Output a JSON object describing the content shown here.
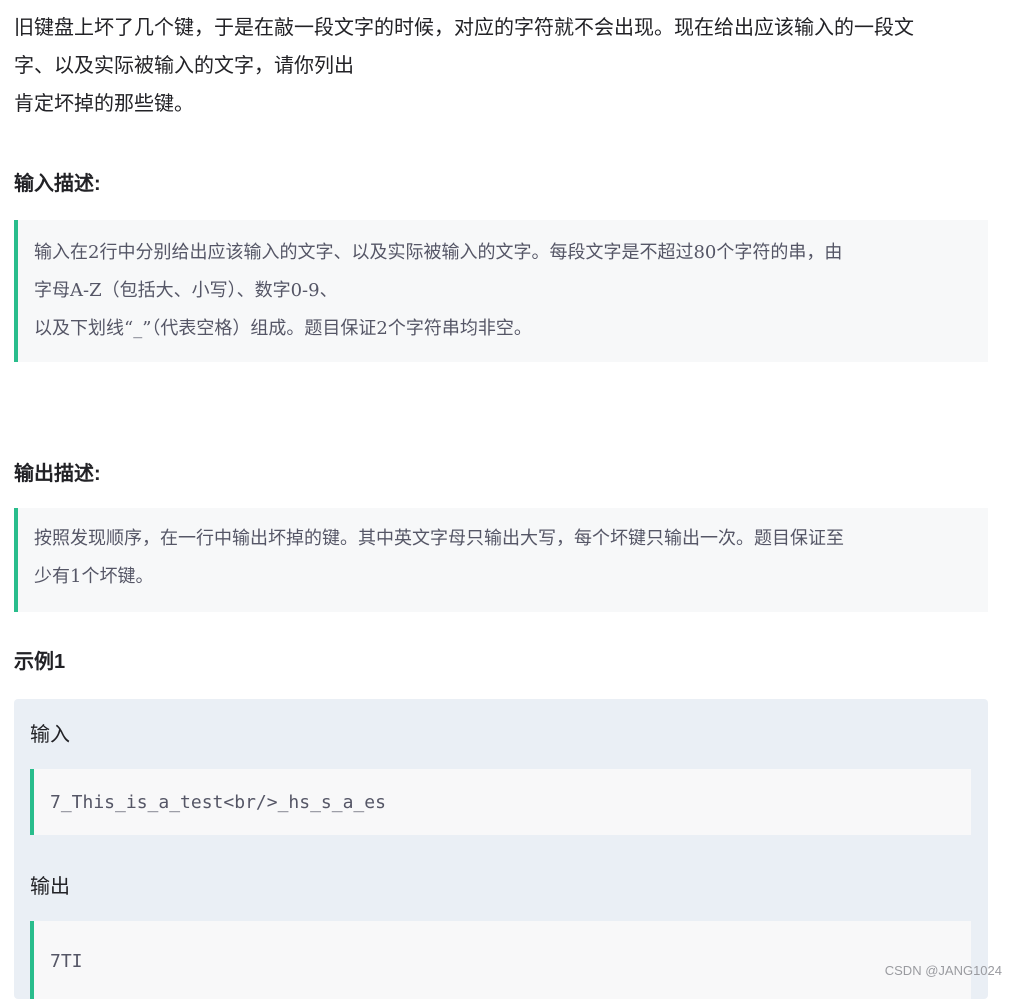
{
  "intro": {
    "lines": [
      "旧键盘上坏了几个键，于是在敲一段文字的时候，对应的字符就不会出现。现在给出应该输入的一段文",
      "字、以及实际被输入的文字，请你列出",
      "肯定坏掉的那些键。"
    ]
  },
  "input_section": {
    "heading": "输入描述:",
    "lines": [
      "输入在2行中分别给出应该输入的文字、以及实际被输入的文字。每段文字是不超过80个字符的串，由",
      "字母A-Z（包括大、小写）、数字0-9、",
      "以及下划线“_”（代表空格）组成。题目保证2个字符串均非空。"
    ]
  },
  "output_section": {
    "heading": "输出描述:",
    "lines": [
      "按照发现顺序，在一行中输出坏掉的键。其中英文字母只输出大写，每个坏键只输出一次。题目保证至",
      "少有1个坏键。"
    ]
  },
  "example": {
    "heading": "示例1",
    "input_label": "输入",
    "input_value": "7_This_is_a_test<br/>_hs_s_a_es",
    "output_label": "输出",
    "output_value": "7TI"
  },
  "watermark": "CSDN @JANG1024",
  "colors": {
    "accent": "#29bd8c",
    "quote_bg": "#f7f8f9",
    "example_bg": "#eaeff5"
  }
}
